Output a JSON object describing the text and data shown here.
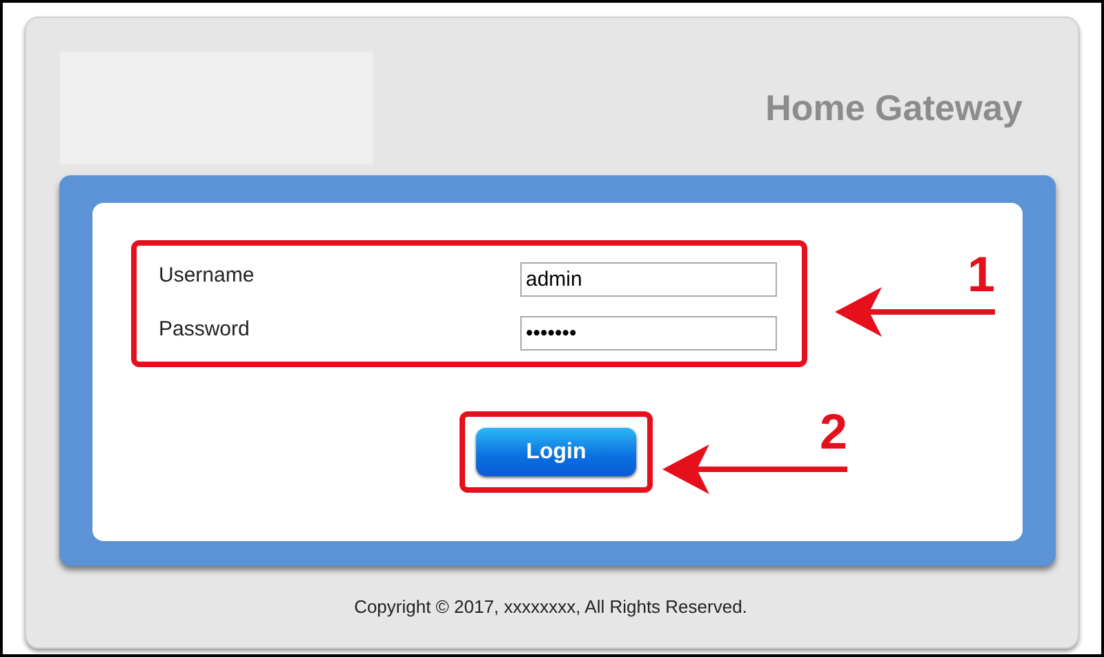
{
  "header": {
    "title": "Home Gateway"
  },
  "login_form": {
    "fields": [
      {
        "label": "Username",
        "value": "admin"
      },
      {
        "label": "Password",
        "value": "•••••••"
      }
    ],
    "button": "Login"
  },
  "annotations": [
    {
      "label": "1"
    },
    {
      "label": "2"
    }
  ],
  "footer": "Copyright © 2017, xxxxxxxx, All Rights Reserved."
}
